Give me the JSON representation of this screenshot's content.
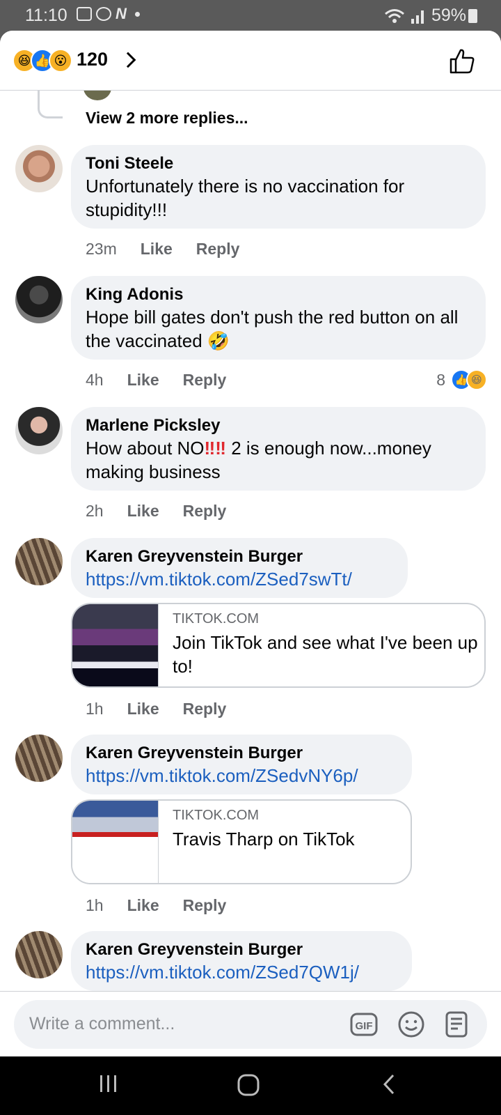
{
  "status_bar": {
    "time": "11:10",
    "battery": "59%",
    "icons": [
      "gallery-icon",
      "whatsapp-icon",
      "n-app-icon",
      "dot-icon",
      "wifi-icon",
      "signal-icon",
      "battery-icon"
    ]
  },
  "reactions_bar": {
    "count": "120",
    "emojis": [
      "haha",
      "like",
      "wow"
    ]
  },
  "previous_thread": {
    "view_more": "View 2 more replies..."
  },
  "comments": [
    {
      "name": "Toni Steele",
      "text": "Unfortunately there is no vaccination for stupidity!!!",
      "time": "23m",
      "like": "Like",
      "reply": "Reply"
    },
    {
      "name": "King Adonis",
      "text": "Hope bill gates don't push the red button on all the vaccinated",
      "emoji": "🤣",
      "time": "4h",
      "like": "Like",
      "reply": "Reply",
      "reaction_count": "8"
    },
    {
      "name": "Marlene Picksley",
      "text_a": "How about NO",
      "text_b": "‼‼",
      "text_c": "2 is enough now...money making business",
      "time": "2h",
      "like": "Like",
      "reply": "Reply"
    },
    {
      "name": "Karen Greyvenstein Burger",
      "link": "https://vm.tiktok.com/ZSed7swTt/",
      "card_domain": "TIKTOK.COM",
      "card_title": "Join TikTok and see what I've been up to!",
      "time": "1h",
      "like": "Like",
      "reply": "Reply"
    },
    {
      "name": "Karen Greyvenstein Burger",
      "link": "https://vm.tiktok.com/ZSedvNY6p/",
      "card_domain": "TIKTOK.COM",
      "card_title": "Travis Tharp on TikTok",
      "time": "1h",
      "like": "Like",
      "reply": "Reply"
    },
    {
      "name": "Karen Greyvenstein Burger",
      "link": "https://vm.tiktok.com/ZSed7QW1j/"
    }
  ],
  "composer": {
    "placeholder": "Write a comment...",
    "gif_label": "GIF"
  },
  "colors": {
    "link": "#1b5fbf",
    "bubble": "#f0f2f5",
    "meta": "#65676b",
    "like_blue": "#1877f2"
  }
}
